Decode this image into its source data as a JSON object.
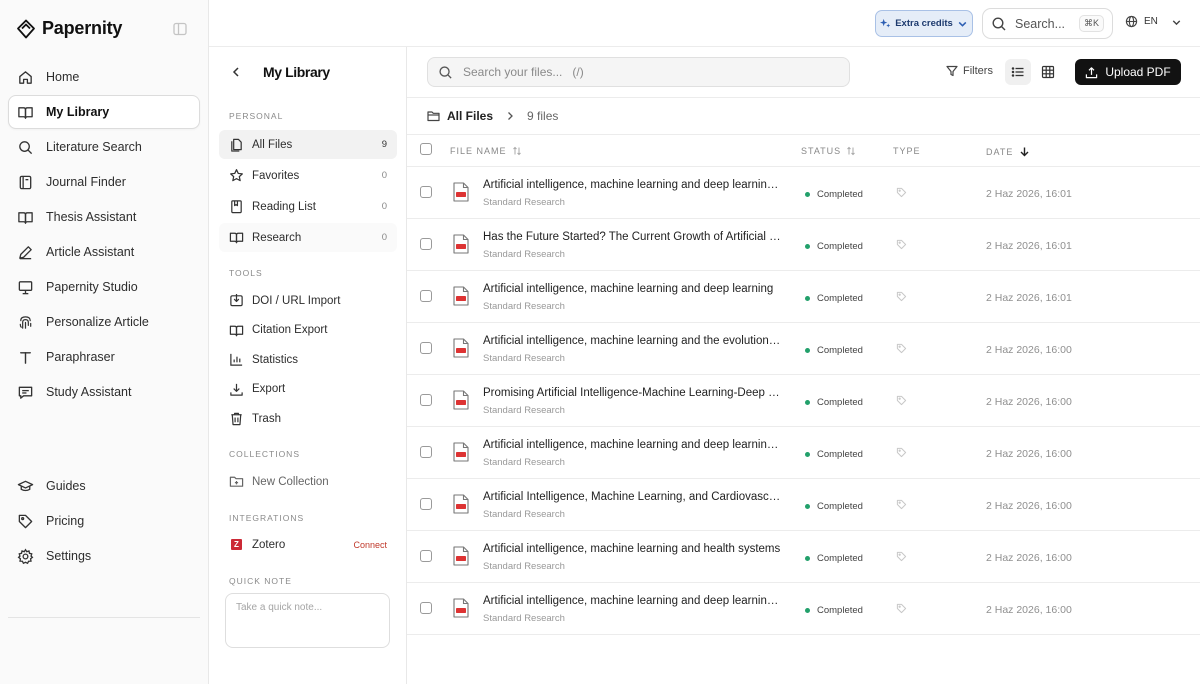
{
  "app": {
    "name": "Papernity"
  },
  "sidebar": {
    "items": [
      {
        "label": "Home",
        "icon": "home-icon"
      },
      {
        "label": "My Library",
        "icon": "book-open-icon",
        "active": true
      },
      {
        "label": "Literature Search",
        "icon": "search-icon"
      },
      {
        "label": "Journal Finder",
        "icon": "journal-icon"
      },
      {
        "label": "Thesis Assistant",
        "icon": "book-open-icon"
      },
      {
        "label": "Article Assistant",
        "icon": "pen-icon"
      },
      {
        "label": "Papernity Studio",
        "icon": "presentation-icon"
      },
      {
        "label": "Personalize Article",
        "icon": "fingerprint-icon"
      },
      {
        "label": "Paraphraser",
        "icon": "text-icon"
      },
      {
        "label": "Study Assistant",
        "icon": "message-icon"
      }
    ],
    "bottom": [
      {
        "label": "Guides",
        "icon": "graduation-cap-icon"
      },
      {
        "label": "Pricing",
        "icon": "tag-icon"
      },
      {
        "label": "Settings",
        "icon": "gear-icon"
      }
    ]
  },
  "library": {
    "title": "My Library",
    "personal_label": "PERSONAL",
    "personal": [
      {
        "label": "All Files",
        "count": "9",
        "icon": "files-icon"
      },
      {
        "label": "Favorites",
        "count": "0",
        "icon": "star-icon"
      },
      {
        "label": "Reading List",
        "count": "0",
        "icon": "bookmark-book-icon"
      },
      {
        "label": "Research",
        "count": "0",
        "icon": "book-open-icon"
      }
    ],
    "tools_label": "TOOLS",
    "tools": [
      {
        "label": "DOI / URL Import",
        "icon": "import-icon"
      },
      {
        "label": "Citation Export",
        "icon": "book-open-icon"
      },
      {
        "label": "Statistics",
        "icon": "bar-chart-icon"
      },
      {
        "label": "Export",
        "icon": "download-icon"
      },
      {
        "label": "Trash",
        "icon": "trash-icon"
      }
    ],
    "collections_label": "COLLECTIONS",
    "new_collection": "New Collection",
    "integrations_label": "INTEGRATIONS",
    "zotero": {
      "badge": "Z",
      "label": "Zotero",
      "action": "Connect"
    },
    "quick_note_label": "QUICK NOTE",
    "quick_note_placeholder": "Take a quick note..."
  },
  "topbar": {
    "credits": "Extra credits",
    "search_label": "Search...",
    "search_kbd": "⌘K",
    "lang": "EN"
  },
  "main": {
    "search_placeholder": "Search your files...   (/)",
    "filters_label": "Filters",
    "upload_label": "Upload PDF",
    "breadcrumb_all": "All Files",
    "breadcrumb_count": "9 files",
    "columns": {
      "name": "FILE NAME",
      "status": "STATUS",
      "type": "TYPE",
      "date": "DATE"
    },
    "files": [
      {
        "name": "Artificial intelligence, machine learning and deep learning in advanced robotics, a review",
        "sub": "Standard Research",
        "status": "Completed",
        "date": "2 Haz 2026, 16:01"
      },
      {
        "name": "Has the Future Started? The Current Growth of Artificial Intelligence",
        "sub": "Standard Research",
        "status": "Completed",
        "date": "2 Haz 2026, 16:01"
      },
      {
        "name": "Artificial intelligence, machine learning and deep learning",
        "sub": "Standard Research",
        "status": "Completed",
        "date": "2 Haz 2026, 16:01"
      },
      {
        "name": "Artificial intelligence, machine learning and the evolution of healthcare",
        "sub": "Standard Research",
        "status": "Completed",
        "date": "2 Haz 2026, 16:00"
      },
      {
        "name": "Promising Artificial Intelligence-Machine Learning-Deep Learning Algorithms",
        "sub": "Standard Research",
        "status": "Completed",
        "date": "2 Haz 2026, 16:00"
      },
      {
        "name": "Artificial intelligence, machine learning and deep learning definitions",
        "sub": "Standard Research",
        "status": "Completed",
        "date": "2 Haz 2026, 16:00"
      },
      {
        "name": "Artificial Intelligence, Machine Learning, and Cardiovascular Disease",
        "sub": "Standard Research",
        "status": "Completed",
        "date": "2 Haz 2026, 16:00"
      },
      {
        "name": "Artificial intelligence, machine learning and health systems",
        "sub": "Standard Research",
        "status": "Completed",
        "date": "2 Haz 2026, 16:00"
      },
      {
        "name": "Artificial intelligence, machine learning and deep learning for beginners",
        "sub": "Standard Research",
        "status": "Completed",
        "date": "2 Haz 2026, 16:00"
      }
    ]
  },
  "colors": {
    "accent": "#121212",
    "status_completed": "#22a06b",
    "credits_bg": "#e5edf8"
  }
}
